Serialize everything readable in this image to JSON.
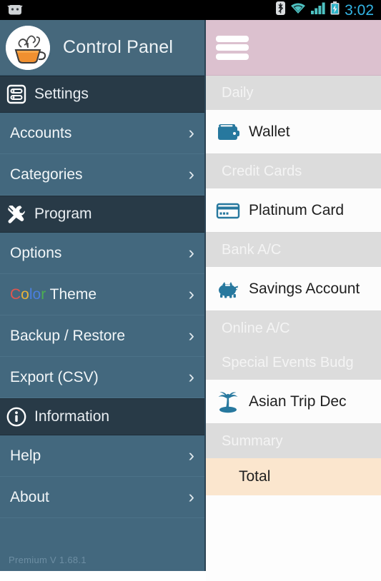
{
  "statusbar": {
    "clock": "3:02",
    "icons": [
      "android-head-icon",
      "bluetooth-icon",
      "wifi-icon",
      "signal-icon",
      "battery-charging-icon"
    ]
  },
  "sidebar": {
    "app_title": "Control Panel",
    "logo_icon": "coffee-cup-logo",
    "version": "Premium V 1.68.1",
    "sections": [
      {
        "key": "settings",
        "label": "Settings",
        "icon": "settings-sliders-icon",
        "items": [
          {
            "label": "Accounts",
            "chevron": "›"
          },
          {
            "label": "Categories",
            "chevron": "›"
          }
        ]
      },
      {
        "key": "program",
        "label": "Program",
        "icon": "wrench-screwdriver-icon",
        "items": [
          {
            "label": "Options",
            "chevron": "›"
          },
          {
            "label": "Color Theme",
            "chevron": "›",
            "colored": true,
            "color_chars": [
              {
                "ch": "C",
                "color": "#e0564f"
              },
              {
                "ch": "o",
                "color": "#e8b339"
              },
              {
                "ch": "l",
                "color": "#4a7fe0"
              },
              {
                "ch": "o",
                "color": "#4a7fe0"
              },
              {
                "ch": "r",
                "color": "#4caf50"
              }
            ],
            "rest": " Theme"
          },
          {
            "label": "Backup / Restore",
            "chevron": "›"
          },
          {
            "label": "Export (CSV)",
            "chevron": "›"
          }
        ]
      },
      {
        "key": "information",
        "label": "Information",
        "icon": "info-circle-icon",
        "items": [
          {
            "label": "Help",
            "chevron": "›"
          },
          {
            "label": "About",
            "chevron": "›"
          }
        ]
      }
    ]
  },
  "content": {
    "menu_icon": "hamburger-menu-icon",
    "header_color": "#dcc1cf",
    "rows": [
      {
        "type": "group",
        "label": "Daily"
      },
      {
        "type": "item",
        "label": "Wallet",
        "icon": "wallet-icon"
      },
      {
        "type": "group",
        "label": "Credit Cards"
      },
      {
        "type": "item",
        "label": "Platinum Card",
        "icon": "credit-card-icon"
      },
      {
        "type": "group",
        "label": "Bank A/C"
      },
      {
        "type": "item",
        "label": "Savings Account",
        "icon": "piggy-bank-icon"
      },
      {
        "type": "group",
        "label": "Online A/C"
      },
      {
        "type": "group",
        "label": "Special Events Budg"
      },
      {
        "type": "item",
        "label": "Asian Trip Dec",
        "icon": "palm-tree-icon"
      },
      {
        "type": "group",
        "label": "Summary"
      },
      {
        "type": "total",
        "label": "Total"
      }
    ],
    "accent_icon_color": "#27789e",
    "total_row_color": "#fbe6ce"
  }
}
